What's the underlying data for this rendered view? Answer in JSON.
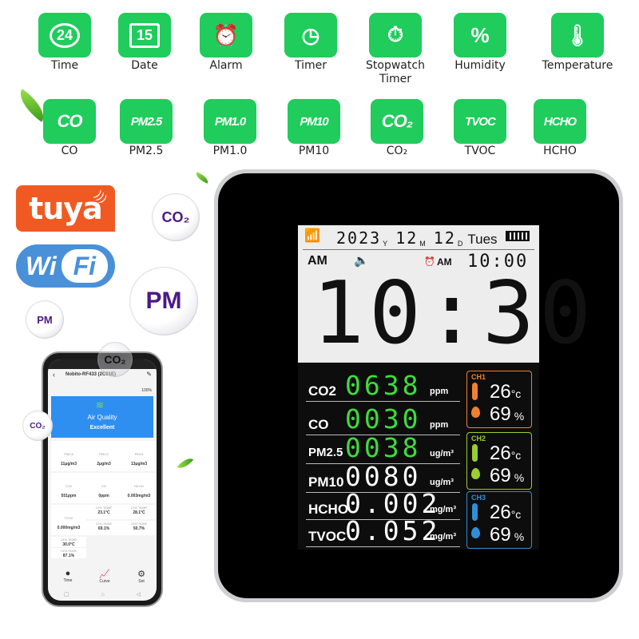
{
  "features_row1": [
    {
      "icon": "clock-24-icon",
      "glyph": "24",
      "label": "Time"
    },
    {
      "icon": "calendar-icon",
      "glyph": "15",
      "label": "Date"
    },
    {
      "icon": "alarm-clock-icon",
      "glyph": "⏰",
      "label": "Alarm"
    },
    {
      "icon": "timer-icon",
      "glyph": "◷",
      "label": "Timer"
    },
    {
      "icon": "stopwatch-icon",
      "glyph": "⏱",
      "label": "Stopwatch\nTimer"
    },
    {
      "icon": "humidity-drop-icon",
      "glyph": "%",
      "label": "Humidity"
    },
    {
      "icon": "thermometer-icon",
      "glyph": "🌡",
      "label": "Temperature"
    }
  ],
  "features_row2": [
    {
      "icon": "co-icon",
      "glyph": "CO",
      "label": "CO"
    },
    {
      "icon": "pm25-icon",
      "glyph": "PM2.5",
      "label": "PM2.5"
    },
    {
      "icon": "pm10-small-icon",
      "glyph": "PM1.0",
      "label": "PM1.0"
    },
    {
      "icon": "pm10-icon",
      "glyph": "PM10",
      "label": "PM10"
    },
    {
      "icon": "co2-icon",
      "glyph": "CO₂",
      "label": "CO₂"
    },
    {
      "icon": "tvoc-icon",
      "glyph": "TVOC",
      "label": "TVOC"
    },
    {
      "icon": "hcho-icon",
      "glyph": "HCHO",
      "label": "HCHO"
    }
  ],
  "brands": {
    "tuya": "tuya",
    "wifi_left": "Wi",
    "wifi_right": "Fi"
  },
  "bubbles": {
    "co2": "CO₂",
    "pm_big": "PM",
    "pm_small": "PM",
    "co2_small": "CO₂",
    "co2_phone": "CO₂"
  },
  "lcd": {
    "year": "2023",
    "year_unit": "Y",
    "month": "12",
    "month_unit": "M",
    "day": "12",
    "day_unit": "D",
    "weekday": "Tues",
    "ampm": "AM",
    "alarm_ampm": "AM",
    "alarm_time": "10:00",
    "main_time": "10:30",
    "readings": [
      {
        "label": "CO2",
        "value": "0638",
        "unit": "ppm",
        "color": "#3ddc3d"
      },
      {
        "label": "CO",
        "value": "0030",
        "unit": "ppm",
        "color": "#3ddc3d"
      },
      {
        "label": "PM2.5",
        "value": "0038",
        "unit": "ug/m³",
        "color": "#3ddc3d"
      },
      {
        "label": "PM10",
        "value": "0080",
        "unit": "ug/m³",
        "color": "#ffffff"
      },
      {
        "label": "HCHO",
        "value": "0.002",
        "unit": "mg/m³",
        "color": "#ffffff"
      },
      {
        "label": "TVOC",
        "value": "0.052",
        "unit": "mg/m³",
        "color": "#ffffff"
      }
    ],
    "channels": [
      {
        "name": "CH1",
        "temp": "26",
        "temp_unit": "°c",
        "hum": "69",
        "hum_unit": "%",
        "color": "#f08030"
      },
      {
        "name": "CH2",
        "temp": "26",
        "temp_unit": "°c",
        "hum": "69",
        "hum_unit": "%",
        "color": "#9acd32"
      },
      {
        "name": "CH3",
        "temp": "26",
        "temp_unit": "°c",
        "hum": "69",
        "hum_unit": "%",
        "color": "#2e8fd8"
      }
    ]
  },
  "phone": {
    "device_name": "Nobito-RF433 (2C01E)",
    "battery": "100%",
    "air_quality_title": "Air Quality",
    "air_quality_status": "Excellent",
    "cells": [
      {
        "name": "PM2.5",
        "value": "11μg/m3"
      },
      {
        "name": "PM1.0",
        "value": "2μg/m3"
      },
      {
        "name": "PM10",
        "value": "13μg/m3"
      },
      {
        "name": "CO2",
        "value": "551ppm"
      },
      {
        "name": "CO",
        "value": "0ppm"
      },
      {
        "name": "HCHO",
        "value": "0.003mg/m3"
      },
      {
        "name": "TVOC",
        "value": "0.000mg/m3"
      },
      {
        "name": "CH1 TEMP",
        "value": "23.1°C"
      },
      {
        "name": "CH2 TEMP",
        "value": "28.1°C"
      },
      {
        "name": "CH1 HUMI",
        "value": "69.1%"
      },
      {
        "name": "CH2 HUMI",
        "value": "50.7%"
      },
      {
        "name": "CH3 TEMP",
        "value": "30.0°C"
      },
      {
        "name": "CH3 HUMI",
        "value": "87.1%"
      }
    ],
    "nav": [
      {
        "icon": "clock-icon",
        "label": "Time"
      },
      {
        "icon": "chart-icon",
        "label": "Curve"
      },
      {
        "icon": "gear-icon",
        "label": "Set"
      }
    ]
  }
}
